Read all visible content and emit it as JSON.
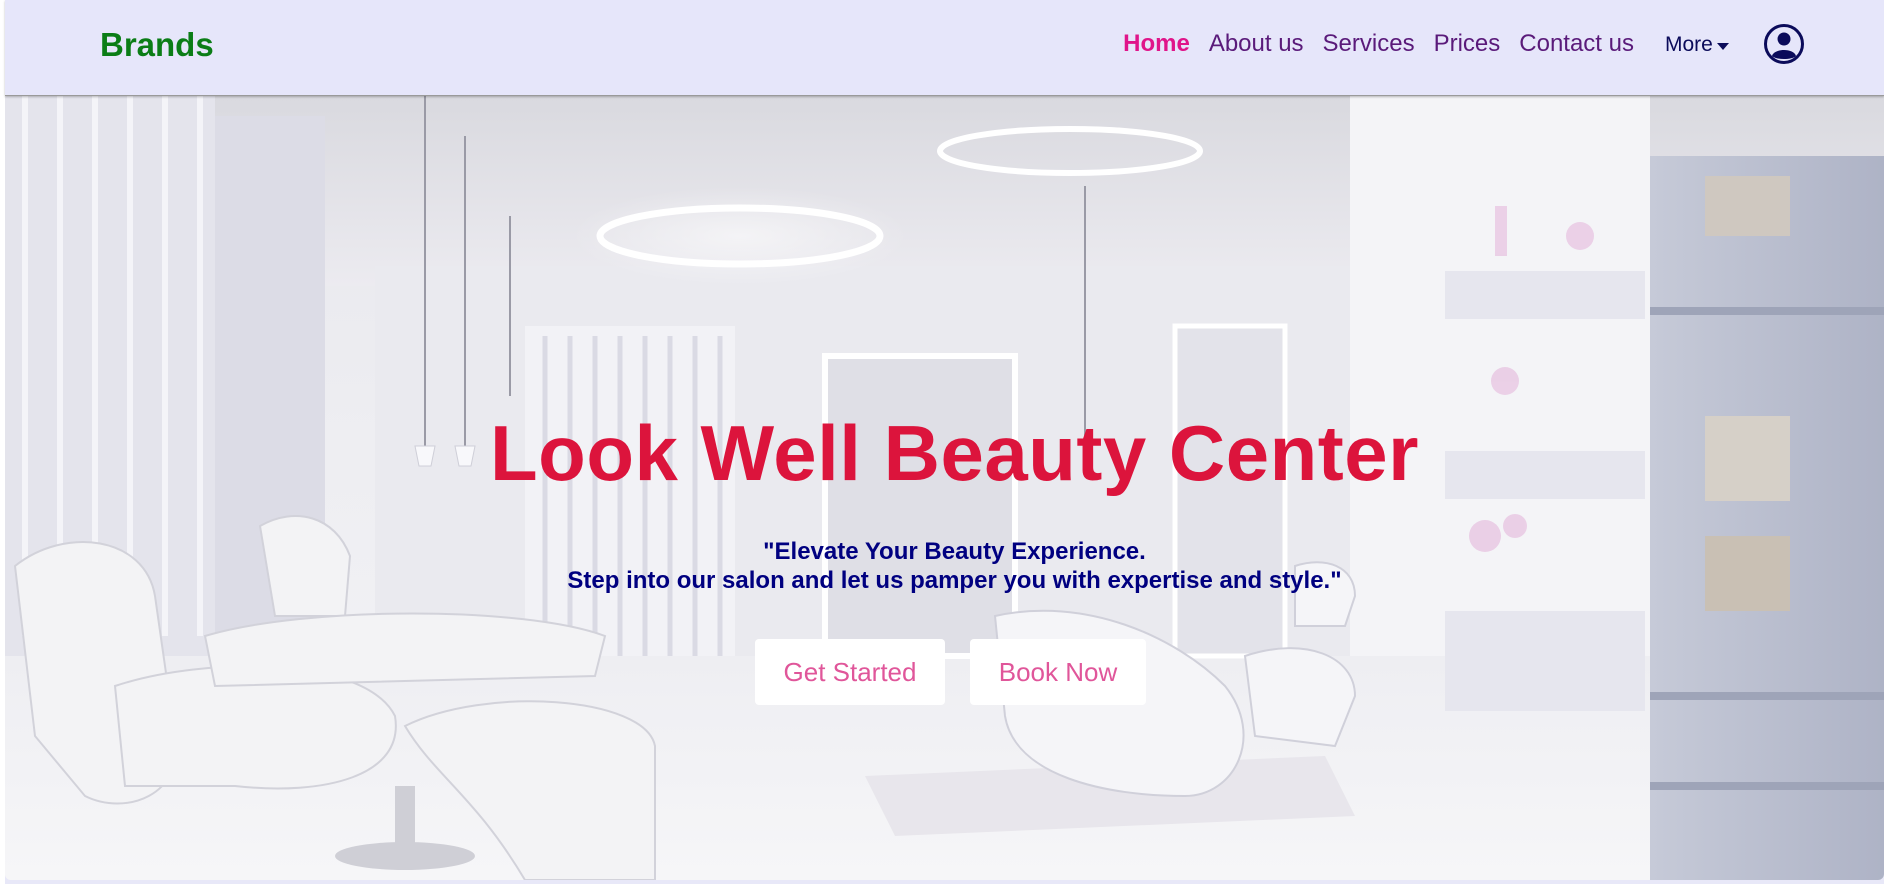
{
  "navbar": {
    "brand": "Brands",
    "links": [
      "Home",
      "About us",
      "Services",
      "Prices",
      "Contact us"
    ],
    "active_link": "Home",
    "more_label": "More",
    "more_icon": "caret-down-icon",
    "profile_icon": "user-circle-icon"
  },
  "hero": {
    "title": "Look Well Beauty Center",
    "tagline_line1": "\"Elevate Your Beauty Experience.",
    "tagline_line2": "Step into our salon and let us pamper you with expertise and style.\"",
    "get_started_label": "Get Started",
    "book_now_label": "Book Now",
    "background": "white salon interior photo"
  },
  "colors": {
    "brand": "#0b7d16",
    "nav_active": "#e0158a",
    "nav_link": "#5a1a7a",
    "navbar_bg": "#e6e6fa",
    "title": "#dc143c",
    "tagline": "#000080",
    "button_text": "#e0569a"
  }
}
